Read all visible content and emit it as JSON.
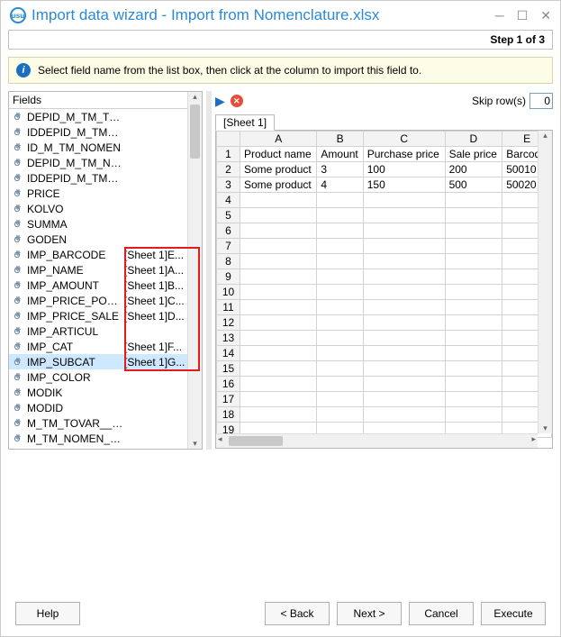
{
  "window": {
    "title": "Import data wizard - Import from Nomenclature.xlsx",
    "step": "Step 1 of 3"
  },
  "instruction": "Select field name from the list box, then click at the column to import this field to.",
  "fields": {
    "header": "Fields",
    "items": [
      {
        "name": "DEPID_M_TM_TOVAR",
        "map": ""
      },
      {
        "name": "IDDEPID_M_TM_T...",
        "map": ""
      },
      {
        "name": "ID_M_TM_NOMEN",
        "map": ""
      },
      {
        "name": "DEPID_M_TM_NO...",
        "map": ""
      },
      {
        "name": "IDDEPID_M_TM_N...",
        "map": ""
      },
      {
        "name": "PRICE",
        "map": ""
      },
      {
        "name": "KOLVO",
        "map": ""
      },
      {
        "name": "SUMMA",
        "map": ""
      },
      {
        "name": "GODEN",
        "map": ""
      },
      {
        "name": "IMP_BARCODE",
        "map": "[Sheet 1]E..."
      },
      {
        "name": "IMP_NAME",
        "map": "[Sheet 1]A..."
      },
      {
        "name": "IMP_AMOUNT",
        "map": "[Sheet 1]B..."
      },
      {
        "name": "IMP_PRICE_POKUP...",
        "map": "[Sheet 1]C..."
      },
      {
        "name": "IMP_PRICE_SALE",
        "map": "[Sheet 1]D..."
      },
      {
        "name": "IMP_ARTICUL",
        "map": ""
      },
      {
        "name": "IMP_CAT",
        "map": "[Sheet 1]F..."
      },
      {
        "name": "IMP_SUBCAT",
        "map": "[Sheet 1]G...",
        "selected": true
      },
      {
        "name": "IMP_COLOR",
        "map": ""
      },
      {
        "name": "MODIK",
        "map": ""
      },
      {
        "name": "MODID",
        "map": ""
      },
      {
        "name": "M_TM_TOVAR___...",
        "map": ""
      },
      {
        "name": "M_TM_NOMEN___...",
        "map": ""
      }
    ]
  },
  "skip": {
    "label": "Skip row(s)",
    "value": "0"
  },
  "sheet_tab": "[Sheet 1]",
  "grid": {
    "columns": [
      "A",
      "B",
      "C",
      "D",
      "E"
    ],
    "rows": [
      {
        "n": "1",
        "cells": [
          "Product name",
          "Amount",
          "Purchase price",
          "Sale price",
          "Barcode"
        ]
      },
      {
        "n": "2",
        "cells": [
          "Some product",
          "3",
          "100",
          "200",
          "50010"
        ]
      },
      {
        "n": "3",
        "cells": [
          "Some product",
          "4",
          "150",
          "500",
          "50020"
        ]
      },
      {
        "n": "4",
        "cells": [
          "",
          "",
          "",
          "",
          ""
        ]
      },
      {
        "n": "5",
        "cells": [
          "",
          "",
          "",
          "",
          ""
        ]
      },
      {
        "n": "6",
        "cells": [
          "",
          "",
          "",
          "",
          ""
        ]
      },
      {
        "n": "7",
        "cells": [
          "",
          "",
          "",
          "",
          ""
        ]
      },
      {
        "n": "8",
        "cells": [
          "",
          "",
          "",
          "",
          ""
        ]
      },
      {
        "n": "9",
        "cells": [
          "",
          "",
          "",
          "",
          ""
        ]
      },
      {
        "n": "10",
        "cells": [
          "",
          "",
          "",
          "",
          ""
        ]
      },
      {
        "n": "11",
        "cells": [
          "",
          "",
          "",
          "",
          ""
        ]
      },
      {
        "n": "12",
        "cells": [
          "",
          "",
          "",
          "",
          ""
        ]
      },
      {
        "n": "13",
        "cells": [
          "",
          "",
          "",
          "",
          ""
        ]
      },
      {
        "n": "14",
        "cells": [
          "",
          "",
          "",
          "",
          ""
        ]
      },
      {
        "n": "15",
        "cells": [
          "",
          "",
          "",
          "",
          ""
        ]
      },
      {
        "n": "16",
        "cells": [
          "",
          "",
          "",
          "",
          ""
        ]
      },
      {
        "n": "17",
        "cells": [
          "",
          "",
          "",
          "",
          ""
        ]
      },
      {
        "n": "18",
        "cells": [
          "",
          "",
          "",
          "",
          ""
        ]
      },
      {
        "n": "19",
        "cells": [
          "",
          "",
          "",
          "",
          ""
        ]
      }
    ]
  },
  "buttons": {
    "help": "Help",
    "back": "< Back",
    "next": "Next >",
    "cancel": "Cancel",
    "execute": "Execute"
  }
}
